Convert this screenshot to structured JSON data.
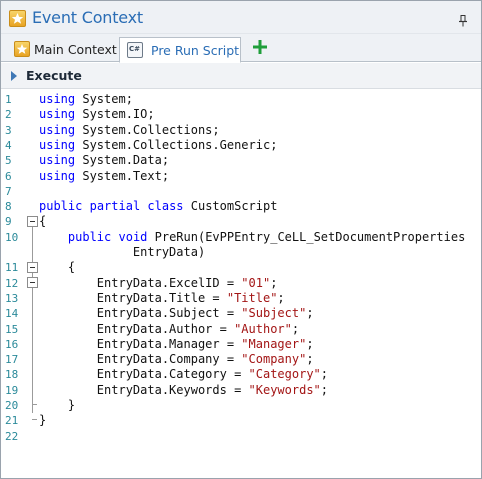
{
  "window": {
    "title": "Event Context",
    "title_icon": "star-icon",
    "pin_icon": "pin-icon"
  },
  "tabs": [
    {
      "label": "Main Context",
      "icon": "star-icon",
      "active": false
    },
    {
      "label": "Pre Run Script",
      "icon": "csharp-file-icon",
      "icon_text": "C#",
      "active": true
    }
  ],
  "add_tab_icon": "plus-icon",
  "execute": {
    "label": "Execute",
    "icon": "triangle-right-icon"
  },
  "colors": {
    "title_text": "#2a6db5",
    "keyword": "#0000ff",
    "string": "#a31515",
    "line_number": "#2b8a9a",
    "add_tab": "#1f9e3a"
  },
  "editor": {
    "line_numbers": [
      "1",
      "2",
      "3",
      "4",
      "5",
      "6",
      "7",
      "8",
      "9",
      "10",
      "11",
      "12",
      "13",
      "14",
      "15",
      "16",
      "17",
      "18",
      "19",
      "20",
      "21",
      "22"
    ],
    "lines": [
      [
        {
          "t": "kw",
          "v": "using"
        },
        {
          "t": "p",
          "v": " System;"
        }
      ],
      [
        {
          "t": "kw",
          "v": "using"
        },
        {
          "t": "p",
          "v": " System.IO;"
        }
      ],
      [
        {
          "t": "kw",
          "v": "using"
        },
        {
          "t": "p",
          "v": " System.Collections;"
        }
      ],
      [
        {
          "t": "kw",
          "v": "using"
        },
        {
          "t": "p",
          "v": " System.Collections.Generic;"
        }
      ],
      [
        {
          "t": "kw",
          "v": "using"
        },
        {
          "t": "p",
          "v": " System.Data;"
        }
      ],
      [
        {
          "t": "kw",
          "v": "using"
        },
        {
          "t": "p",
          "v": " System.Text;"
        }
      ],
      [],
      [
        {
          "t": "kw",
          "v": "public"
        },
        {
          "t": "p",
          "v": " "
        },
        {
          "t": "kw",
          "v": "partial"
        },
        {
          "t": "p",
          "v": " "
        },
        {
          "t": "kw",
          "v": "class"
        },
        {
          "t": "p",
          "v": " CustomScript"
        }
      ],
      [
        {
          "t": "p",
          "v": "{"
        }
      ],
      [
        {
          "t": "p",
          "v": "    "
        },
        {
          "t": "kw",
          "v": "public"
        },
        {
          "t": "p",
          "v": " "
        },
        {
          "t": "kw",
          "v": "void"
        },
        {
          "t": "p",
          "v": " PreRun(EvPPEntry_CeLL_SetDocumentProperties"
        }
      ],
      [
        {
          "t": "p",
          "v": "    {"
        }
      ],
      [
        {
          "t": "p",
          "v": "        EntryData.ExcelID = "
        },
        {
          "t": "str",
          "v": "\"01\""
        },
        {
          "t": "p",
          "v": ";"
        }
      ],
      [
        {
          "t": "p",
          "v": "        EntryData.Title = "
        },
        {
          "t": "str",
          "v": "\"Title\""
        },
        {
          "t": "p",
          "v": ";"
        }
      ],
      [
        {
          "t": "p",
          "v": "        EntryData.Subject = "
        },
        {
          "t": "str",
          "v": "\"Subject\""
        },
        {
          "t": "p",
          "v": ";"
        }
      ],
      [
        {
          "t": "p",
          "v": "        EntryData.Author = "
        },
        {
          "t": "str",
          "v": "\"Author\""
        },
        {
          "t": "p",
          "v": ";"
        }
      ],
      [
        {
          "t": "p",
          "v": "        EntryData.Manager = "
        },
        {
          "t": "str",
          "v": "\"Manager\""
        },
        {
          "t": "p",
          "v": ";"
        }
      ],
      [
        {
          "t": "p",
          "v": "        EntryData.Company = "
        },
        {
          "t": "str",
          "v": "\"Company\""
        },
        {
          "t": "p",
          "v": ";"
        }
      ],
      [
        {
          "t": "p",
          "v": "        EntryData.Category = "
        },
        {
          "t": "str",
          "v": "\"Category\""
        },
        {
          "t": "p",
          "v": ";"
        }
      ],
      [
        {
          "t": "p",
          "v": "        EntryData.Keywords = "
        },
        {
          "t": "str",
          "v": "\"Keywords\""
        },
        {
          "t": "p",
          "v": ";"
        }
      ],
      [
        {
          "t": "p",
          "v": "    }"
        }
      ],
      [
        {
          "t": "p",
          "v": "}"
        }
      ],
      []
    ],
    "wrapped_continuation": "             EntryData)"
  }
}
